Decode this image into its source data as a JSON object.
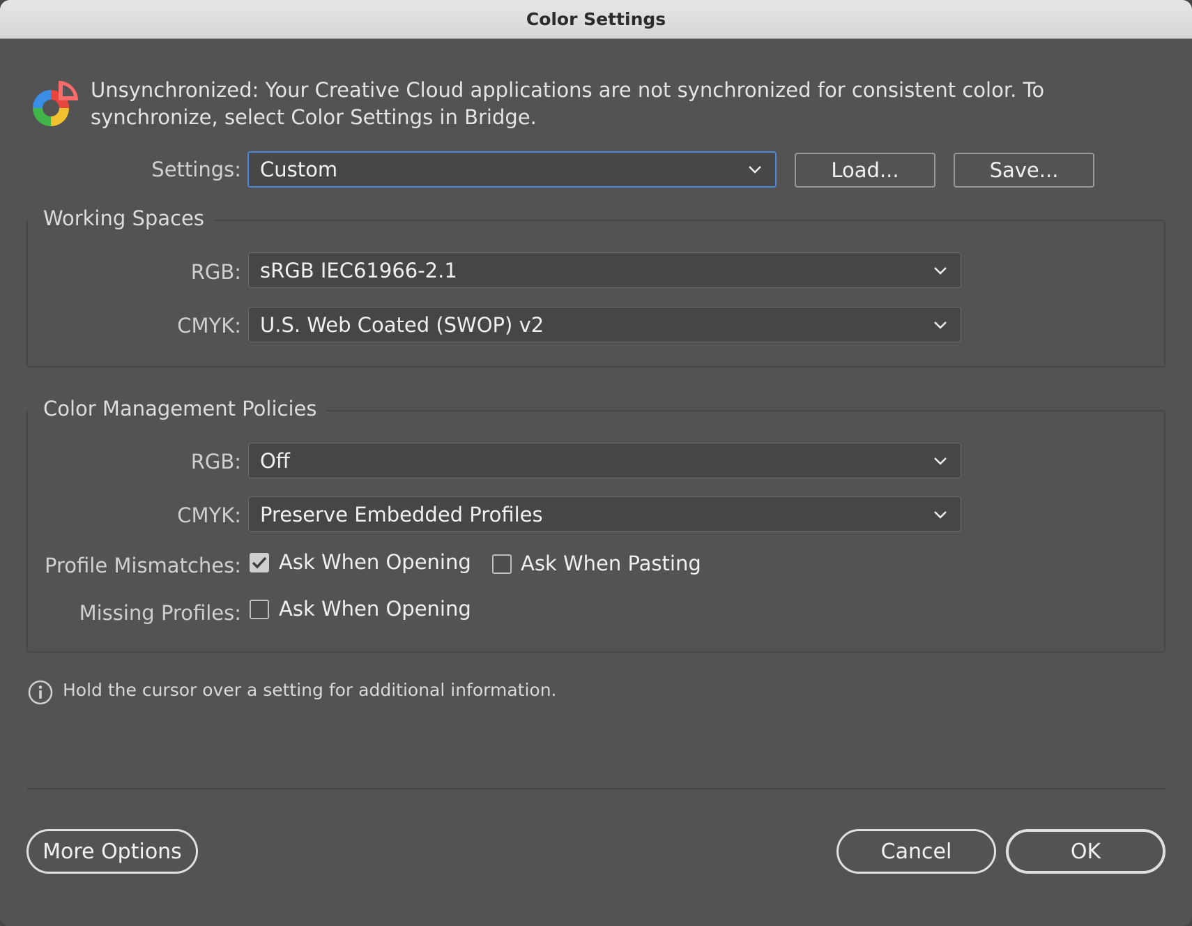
{
  "window": {
    "title": "Color Settings"
  },
  "sync": {
    "icon": "color-sync-icon",
    "message": "Unsynchronized: Your Creative Cloud applications are not synchronized for consistent color. To synchronize, select Color Settings in Bridge."
  },
  "settings": {
    "label": "Settings:",
    "value": "Custom",
    "load_label": "Load...",
    "save_label": "Save..."
  },
  "working_spaces": {
    "title": "Working Spaces",
    "rgb_label": "RGB:",
    "rgb_value": "sRGB IEC61966-2.1",
    "cmyk_label": "CMYK:",
    "cmyk_value": "U.S. Web Coated (SWOP) v2"
  },
  "policies": {
    "title": "Color Management Policies",
    "rgb_label": "RGB:",
    "rgb_value": "Off",
    "cmyk_label": "CMYK:",
    "cmyk_value": "Preserve Embedded Profiles",
    "mismatch_label": "Profile Mismatches:",
    "mismatch_opening_label": "Ask When Opening",
    "mismatch_opening_checked": true,
    "mismatch_pasting_label": "Ask When Pasting",
    "mismatch_pasting_checked": false,
    "missing_label": "Missing Profiles:",
    "missing_opening_label": "Ask When Opening",
    "missing_opening_checked": false
  },
  "info": {
    "icon": "info-icon",
    "text": "Hold the cursor over a setting for additional information."
  },
  "footer": {
    "more_options_label": "More Options",
    "cancel_label": "Cancel",
    "ok_label": "OK"
  },
  "colors": {
    "background": "#535353",
    "focus_ring": "#4a88d9",
    "titlebar": "#dcdcdc"
  }
}
